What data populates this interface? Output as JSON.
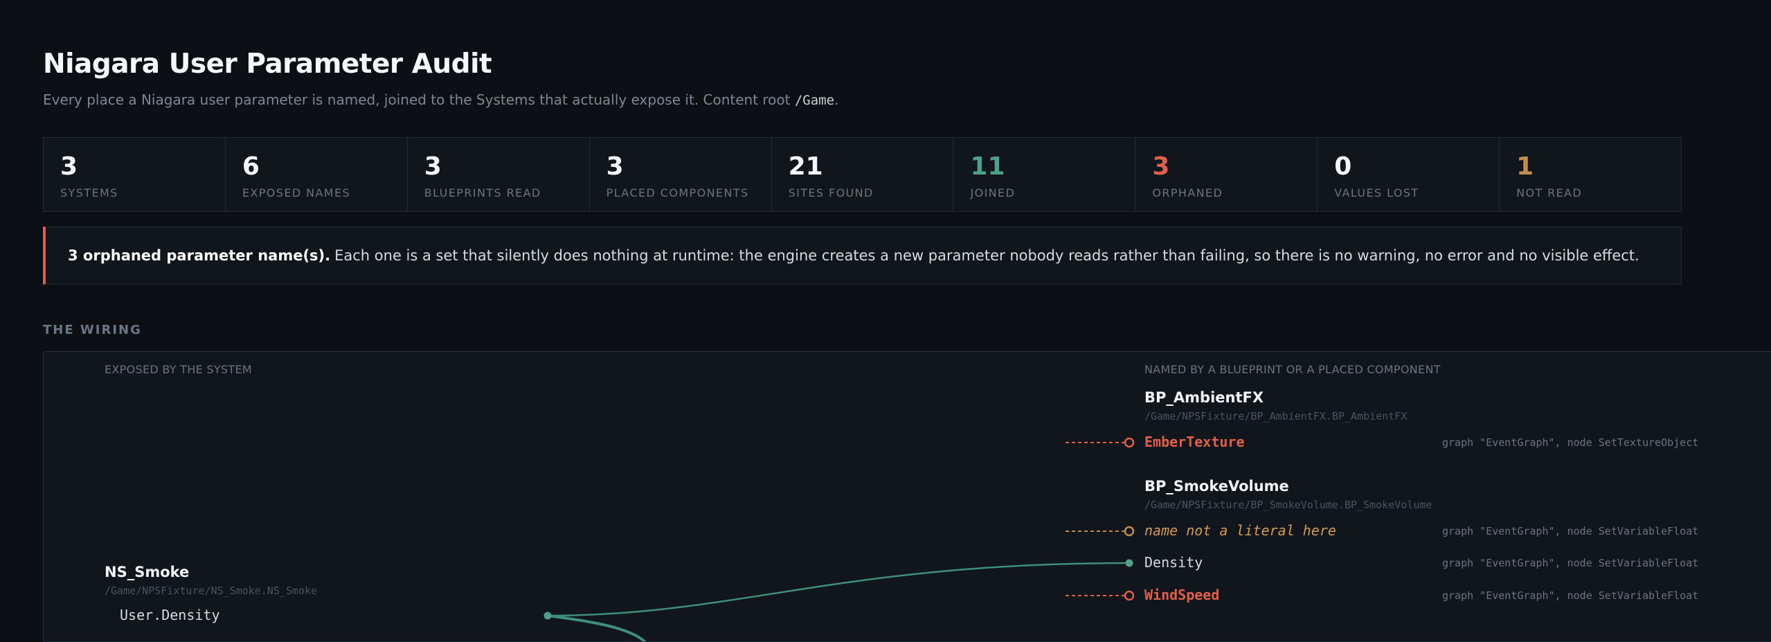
{
  "header": {
    "title": "Niagara User Parameter Audit",
    "subtitle_before": "Every place a Niagara user parameter is named, joined to the Systems that actually expose it. Content root ",
    "subtitle_code": "/Game",
    "subtitle_after": "."
  },
  "stats": [
    {
      "value": "3",
      "label": "SYSTEMS"
    },
    {
      "value": "6",
      "label": "EXPOSED NAMES"
    },
    {
      "value": "3",
      "label": "BLUEPRINTS READ"
    },
    {
      "value": "3",
      "label": "PLACED COMPONENTS"
    },
    {
      "value": "21",
      "label": "SITES FOUND"
    },
    {
      "value": "11",
      "label": "JOINED"
    },
    {
      "value": "3",
      "label": "ORPHANED"
    },
    {
      "value": "0",
      "label": "VALUES LOST"
    },
    {
      "value": "1",
      "label": "NOT READ"
    }
  ],
  "colors": {
    "joined": "#4fa08b",
    "orphaned": "#e0604b",
    "not_read": "#c28d4f",
    "background": "#0c0f14",
    "panel": "#11151c"
  },
  "alert": {
    "bold": "3 orphaned parameter name(s).",
    "text": "Each one is a set that silently does nothing at runtime: the engine creates a new parameter nobody reads rather than failing, so there is no warning, no error and no visible effect."
  },
  "wiring": {
    "section_title": "THE WIRING",
    "left_heading": "EXPOSED BY THE SYSTEM",
    "right_heading": "NAMED BY A BLUEPRINT OR A PLACED COMPONENT",
    "systems": [
      {
        "name": "NS_Smoke",
        "path": "/Game/NPSFixture/NS_Smoke.NS_Smoke",
        "params": [
          "User.Density"
        ]
      }
    ],
    "owners": [
      {
        "name": "BP_AmbientFX",
        "path": "/Game/NPSFixture/BP_AmbientFX.BP_AmbientFX",
        "sites": [
          {
            "param": "EmberTexture",
            "status": "orphaned",
            "where": "graph \"EventGraph\", node SetTextureObject"
          }
        ]
      },
      {
        "name": "BP_SmokeVolume",
        "path": "/Game/NPSFixture/BP_SmokeVolume.BP_SmokeVolume",
        "sites": [
          {
            "param": "name not a literal here",
            "status": "not_read",
            "where": "graph \"EventGraph\", node SetVariableFloat"
          },
          {
            "param": "Density",
            "status": "joined",
            "where": "graph \"EventGraph\", node SetVariableFloat"
          },
          {
            "param": "WindSpeed",
            "status": "orphaned",
            "where": "graph \"EventGraph\", node SetVariableFloat"
          }
        ]
      }
    ]
  }
}
